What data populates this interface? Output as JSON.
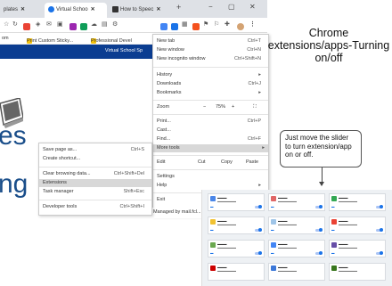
{
  "browser": {
    "tabs": [
      {
        "label": "plates",
        "active": false
      },
      {
        "label": "Virtual Schoo",
        "active": true
      },
      {
        "label": "How to Speec",
        "active": false
      }
    ],
    "new_tab_symbol": "+",
    "window_controls": {
      "minimize": "−",
      "restore": "▢",
      "close": "✕"
    },
    "bookmarks": [
      {
        "label": "om"
      },
      {
        "label": "Print Custom Sticky..."
      },
      {
        "label": "Professional Devel"
      }
    ],
    "banner_text": "Virtual School Sp"
  },
  "chrome_menu": {
    "items": [
      {
        "label": "New tab",
        "shortcut": "Ctrl+T"
      },
      {
        "label": "New window",
        "shortcut": "Ctrl+N"
      },
      {
        "label": "New incognito window",
        "shortcut": "Ctrl+Shift+N"
      },
      {
        "label": "History",
        "shortcut": "▸"
      },
      {
        "label": "Downloads",
        "shortcut": "Ctrl+J"
      },
      {
        "label": "Bookmarks",
        "shortcut": "▸"
      },
      {
        "label": "Print...",
        "shortcut": "Ctrl+P"
      },
      {
        "label": "Cast...",
        "shortcut": ""
      },
      {
        "label": "Find...",
        "shortcut": "Ctrl+F"
      },
      {
        "label": "More tools",
        "shortcut": "▸"
      },
      {
        "label": "Settings",
        "shortcut": ""
      },
      {
        "label": "Help",
        "shortcut": "▸"
      },
      {
        "label": "Exit",
        "shortcut": ""
      }
    ],
    "zoom": {
      "label": "Zoom",
      "minus": "−",
      "value": "75%",
      "plus": "+",
      "fullscreen": "⛶"
    },
    "edit": {
      "label": "Edit",
      "cut": "Cut",
      "copy": "Copy",
      "paste": "Paste"
    },
    "managed": "Managed by mail.fcl..."
  },
  "more_tools_submenu": {
    "items": [
      {
        "label": "Save page as...",
        "shortcut": "Ctrl+S"
      },
      {
        "label": "Create shortcut...",
        "shortcut": ""
      },
      {
        "label": "Clear browsing data...",
        "shortcut": "Ctrl+Shift+Del"
      },
      {
        "label": "Extensions",
        "shortcut": ""
      },
      {
        "label": "Task manager",
        "shortcut": "Shift+Esc"
      },
      {
        "label": "Developer tools",
        "shortcut": "Ctrl+Shift+I"
      }
    ]
  },
  "slide": {
    "title": "Chrome extensions/apps-Turning on/off",
    "callout": "Just move the slider to turn extension/app on or off.",
    "partial_words": [
      "es",
      "ng"
    ]
  },
  "extensions": {
    "cards": [
      {
        "color": "#4a86e8"
      },
      {
        "color": "#e06666"
      },
      {
        "color": "#34a853"
      },
      {
        "color": "#f1c232"
      },
      {
        "color": "#9fc5e8"
      },
      {
        "color": "#ea4335"
      },
      {
        "color": "#6aa84f"
      },
      {
        "color": "#4285f4"
      },
      {
        "color": "#674ea7"
      },
      {
        "color": "#cc0000"
      },
      {
        "color": "#3c78d8"
      },
      {
        "color": "#38761d"
      }
    ]
  }
}
